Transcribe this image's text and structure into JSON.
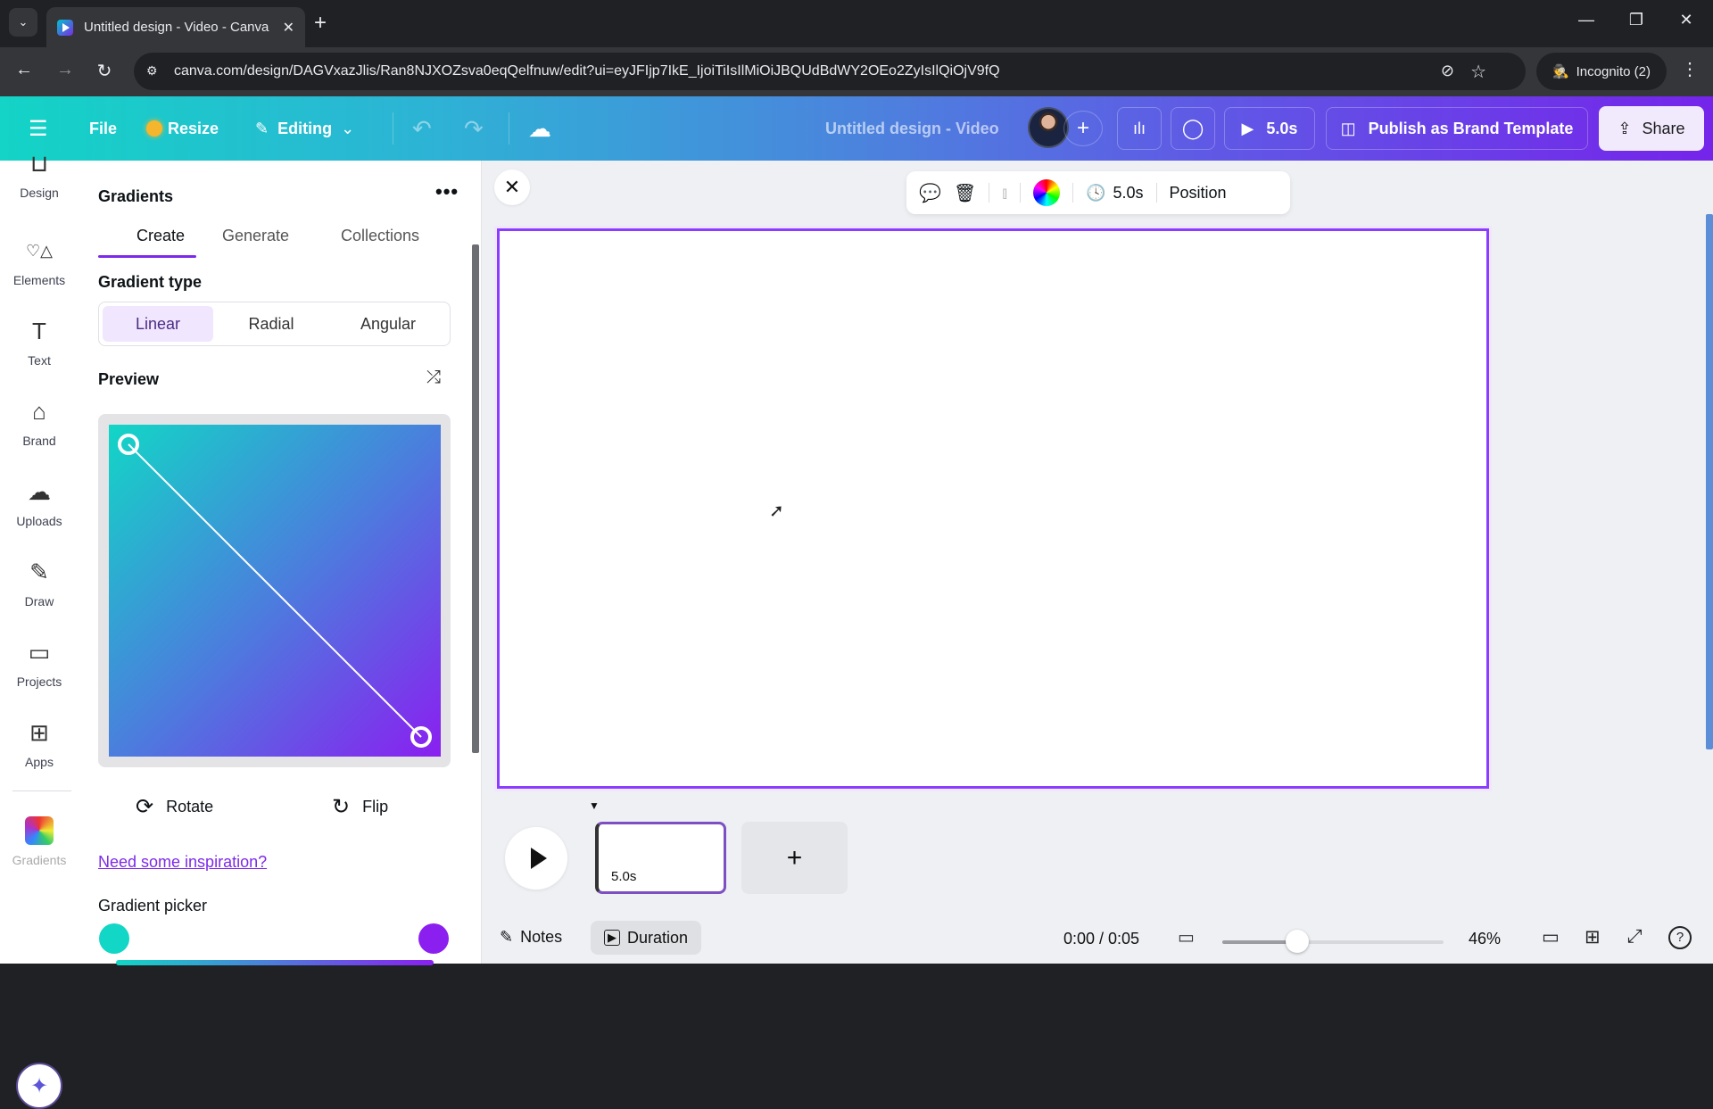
{
  "browser": {
    "tab_title": "Untitled design - Video - Canva",
    "url": "canva.com/design/DAGVxazJlis/Ran8NJXOZsva0eqQelfnuw/edit?ui=eyJFIjp7IkE_IjoiTiIsIlMiOiJBQUdBdWY2OEo2ZyIsIlQiOjV9fQ",
    "profile_label": "Incognito (2)",
    "icons": {
      "tab_search": "⌄",
      "close_tab": "✕",
      "new_tab": "+",
      "back": "←",
      "forward": "→",
      "reload": "↻",
      "site_info": "⚙",
      "eye_off": "⊘",
      "bookmark": "☆",
      "incognito": "🕵",
      "menu": "⋮",
      "minimize": "—",
      "restore": "❐",
      "close": "✕"
    }
  },
  "header": {
    "menu_icon": "☰",
    "file_label": "File",
    "resize_label": "Resize",
    "editing_label": "Editing",
    "undo_icon": "↶",
    "redo_icon": "↷",
    "cloud_icon": "☁",
    "doc_title": "Untitled design - Video",
    "add_icon": "+",
    "insights_icon": "ılı",
    "comment_icon": "◯",
    "play_label": "5.0s",
    "publish_label": "Publish as Brand Template",
    "share_label": "Share",
    "accent_color": "#7d2ae8"
  },
  "rail": {
    "items": [
      {
        "label": "Design",
        "icon": "⊔"
      },
      {
        "label": "Elements",
        "icon": "♡△"
      },
      {
        "label": "Text",
        "icon": "T"
      },
      {
        "label": "Brand",
        "icon": "⌂"
      },
      {
        "label": "Uploads",
        "icon": "☁"
      },
      {
        "label": "Draw",
        "icon": "✎"
      },
      {
        "label": "Projects",
        "icon": "▭"
      },
      {
        "label": "Apps",
        "icon": "⊞"
      }
    ],
    "active_app_label": "Gradients",
    "magic_icon": "✦"
  },
  "panel": {
    "title": "Gradients",
    "more_icon": "•••",
    "tabs": [
      {
        "label": "Create",
        "active": true
      },
      {
        "label": "Generate",
        "active": false
      },
      {
        "label": "Collections",
        "active": false
      }
    ],
    "gradient_type_label": "Gradient type",
    "gradient_types": [
      {
        "label": "Linear",
        "selected": true
      },
      {
        "label": "Radial",
        "selected": false
      },
      {
        "label": "Angular",
        "selected": false
      }
    ],
    "preview_label": "Preview",
    "shuffle_icon": "⤮",
    "rotate_label": "Rotate",
    "rotate_icon": "⟳",
    "flip_label": "Flip",
    "flip_icon": "↻",
    "inspiration_link": "Need some inspiration?",
    "picker_label": "Gradient picker",
    "color_stops": [
      {
        "color": "#12d6c6"
      },
      {
        "color": "#8a1ff0"
      }
    ]
  },
  "canvas": {
    "close_icon": "✕",
    "toolbar": {
      "comment_icon": "💬",
      "delete_icon": "🗑",
      "split_icon": "⫾",
      "duration_label": "5.0s",
      "clock_icon": "🕓",
      "position_label": "Position"
    },
    "frame_border_color": "#8b3dff"
  },
  "timeline": {
    "scene_duration": "5.0s",
    "add_icon": "+",
    "notes_label": "Notes",
    "duration_label": "Duration",
    "timecode": "0:00 / 0:05",
    "zoom_percent": "46%",
    "zoom_value": 46,
    "icons": {
      "notes": "✎",
      "duration": "▶",
      "timeline": "▭",
      "page_view": "▭",
      "grid": "⊞",
      "fullscreen": "⤢",
      "help": "?"
    }
  }
}
